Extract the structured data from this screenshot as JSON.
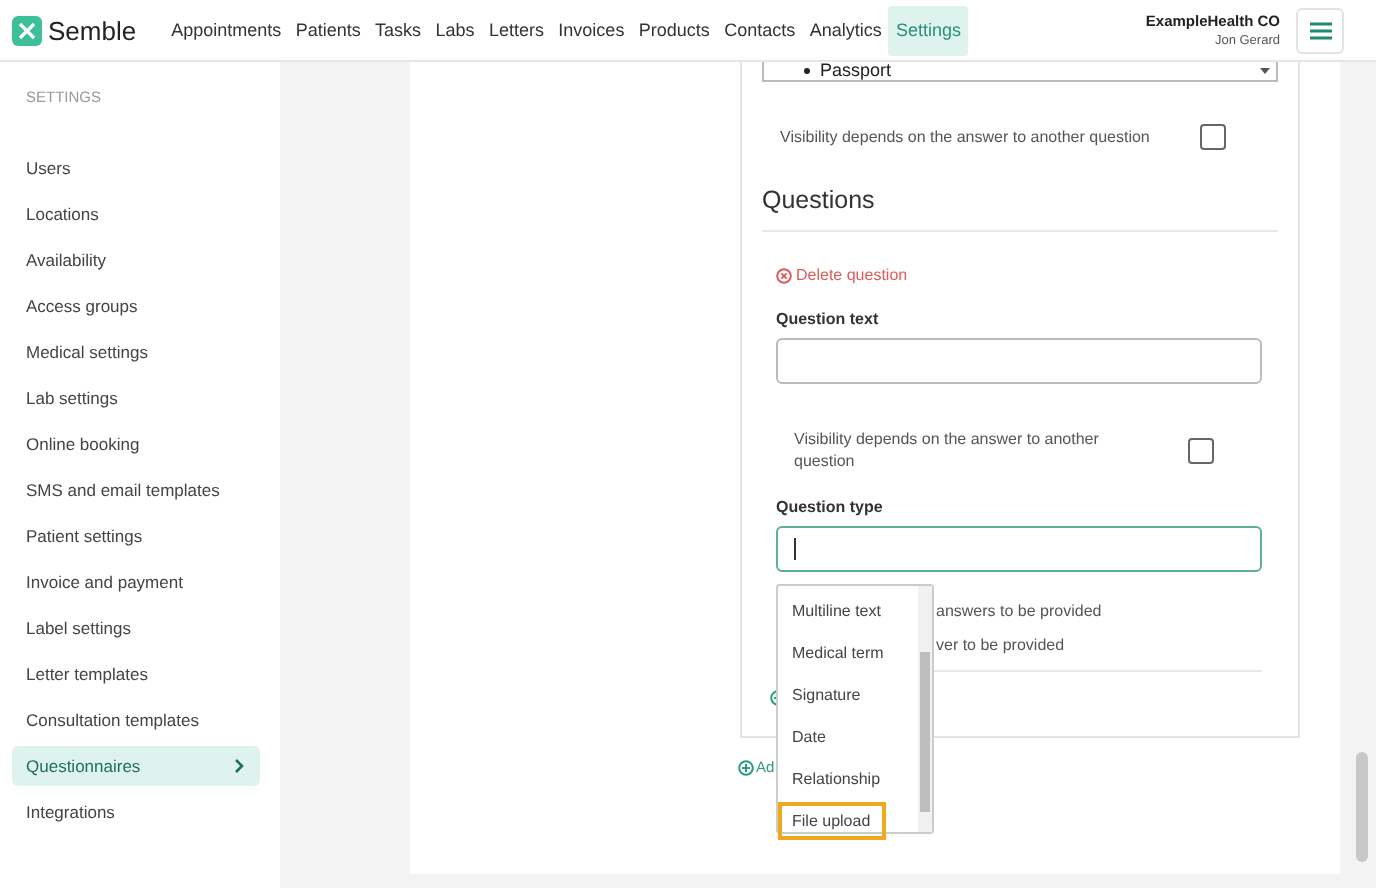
{
  "header": {
    "logo": "Semble",
    "org": "ExampleHealth CO",
    "user": "Jon Gerard",
    "nav": [
      {
        "label": "Appointments",
        "selected": false
      },
      {
        "label": "Patients",
        "selected": false
      },
      {
        "label": "Tasks",
        "selected": false
      },
      {
        "label": "Labs",
        "selected": false
      },
      {
        "label": "Letters",
        "selected": false
      },
      {
        "label": "Invoices",
        "selected": false
      },
      {
        "label": "Products",
        "selected": false
      },
      {
        "label": "Contacts",
        "selected": false
      },
      {
        "label": "Analytics",
        "selected": false
      },
      {
        "label": "Settings",
        "selected": true
      }
    ]
  },
  "sidebar": {
    "heading": "SETTINGS",
    "items": [
      {
        "label": "Users",
        "selected": false
      },
      {
        "label": "Locations",
        "selected": false
      },
      {
        "label": "Availability",
        "selected": false
      },
      {
        "label": "Access groups",
        "selected": false
      },
      {
        "label": "Medical settings",
        "selected": false
      },
      {
        "label": "Lab settings",
        "selected": false
      },
      {
        "label": "Online booking",
        "selected": false
      },
      {
        "label": "SMS and email templates",
        "selected": false
      },
      {
        "label": "Patient settings",
        "selected": false
      },
      {
        "label": "Invoice and payment",
        "selected": false
      },
      {
        "label": "Label settings",
        "selected": false
      },
      {
        "label": "Letter templates",
        "selected": false
      },
      {
        "label": "Consultation templates",
        "selected": false
      },
      {
        "label": "Questionnaires",
        "selected": true
      },
      {
        "label": "Integrations",
        "selected": false
      }
    ]
  },
  "form": {
    "select_value": "Passport",
    "visibility": {
      "label": "Visibility depends on the answer to another question",
      "checked": false
    },
    "section_title": "Questions",
    "delete_label": "Delete question",
    "question_text": {
      "label": "Question text"
    },
    "visibility_2": {
      "label": "Visibility depends on the answer to another question",
      "checked": false
    },
    "question_type": {
      "label": "Question type"
    },
    "covered_rows": [
      "answers to be provided",
      "ver to be provided"
    ],
    "add_label": "Ad"
  },
  "dropdown": {
    "options": [
      {
        "label": "Multiline text",
        "selected": false
      },
      {
        "label": "Medical term",
        "selected": false
      },
      {
        "label": "Signature",
        "selected": false
      },
      {
        "label": "Date",
        "selected": false
      },
      {
        "label": "Relationship",
        "selected": false
      },
      {
        "label": "File upload",
        "selected": true
      }
    ]
  }
}
